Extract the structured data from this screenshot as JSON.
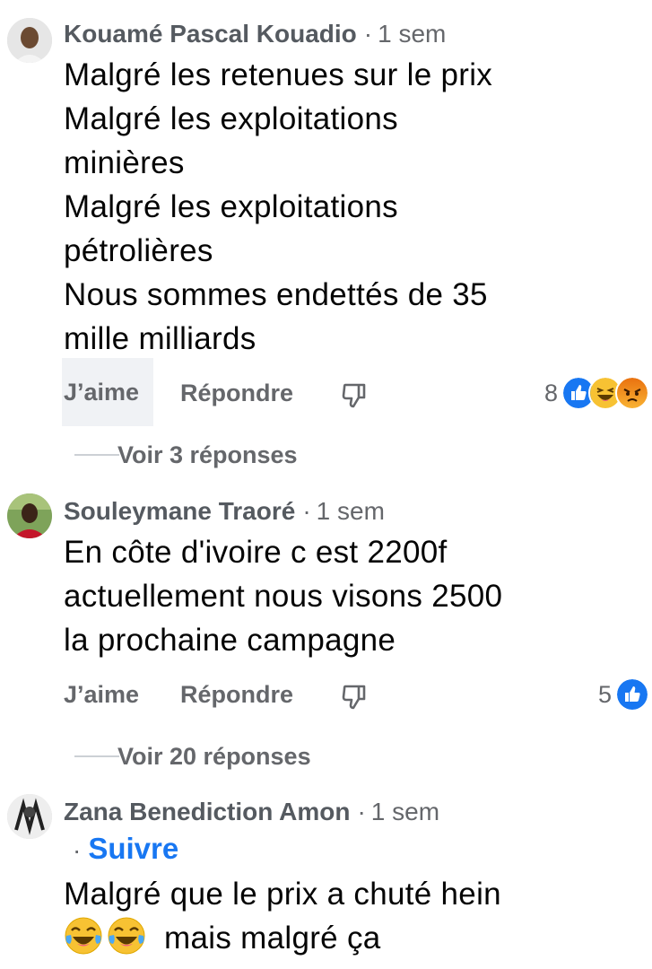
{
  "comments": [
    {
      "author": "Kouamé Pascal Kouadio",
      "time": "1 sem",
      "lines": [
        "Malgré les retenues sur le prix",
        "Malgré les exploitations",
        "minières",
        "Malgré les exploitations",
        "pétrolières",
        "Nous sommes endettés de 35",
        "mille milliards"
      ],
      "like_label": "J’aime",
      "reply_label": "Répondre",
      "reaction_count": "8",
      "reactions": [
        "like-reaction",
        "haha-reaction",
        "angry-reaction"
      ],
      "replies_label": "Voir 3 réponses"
    },
    {
      "author": "Souleymane Traoré",
      "time": "1 sem",
      "lines": [
        "En côte d'ivoire c est 2200f",
        "actuellement nous visons 2500",
        "la prochaine campagne"
      ],
      "like_label": "J’aime",
      "reply_label": "Répondre",
      "reaction_count": "5",
      "reactions": [
        "like-reaction"
      ],
      "replies_label": "Voir 20 réponses"
    },
    {
      "author": "Zana Benediction Amon",
      "time": "1 sem",
      "follow_label": "Suivre",
      "line1": "Malgré que le prix a chuté hein",
      "line2": "mais malgré ça",
      "emojis": [
        "joy-emoji",
        "joy-emoji"
      ]
    }
  ],
  "colors": {
    "link": "#1877f2",
    "secondary": "#65676b",
    "author": "#555a60",
    "like_blue": "#1877f2"
  }
}
